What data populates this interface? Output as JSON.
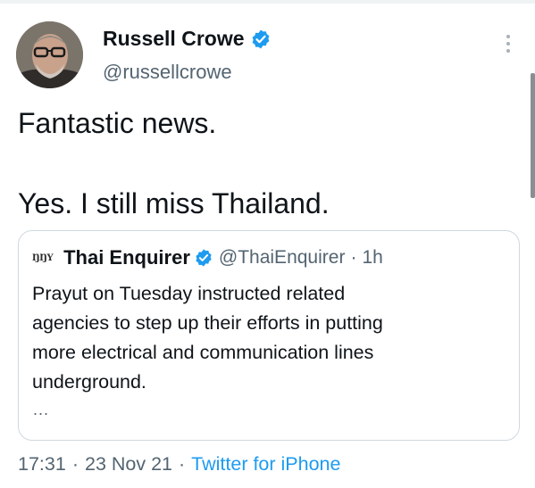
{
  "author": {
    "name": "Russell Crowe",
    "handle": "@russellcrowe",
    "verified": true,
    "avatar_icon": "profile-photo"
  },
  "tweet": {
    "lines": [
      "Fantastic news.",
      "Yes. I still miss Thailand."
    ]
  },
  "quote": {
    "logo_text": "ŊŊY",
    "name": "Thai Enquirer",
    "verified": true,
    "handle": "@ThaiEnquirer",
    "separator": "·",
    "time": "1h",
    "body_lines": [
      "Prayut on Tuesday instructed related",
      "agencies to step up their efforts in putting",
      "more electrical and communication lines",
      "underground."
    ],
    "truncation": "..."
  },
  "meta": {
    "time": "17:31",
    "separator": "·",
    "date": "23 Nov 21",
    "source": "Twitter for iPhone"
  },
  "colors": {
    "primary_text": "#0f1419",
    "secondary_text": "#536471",
    "link_blue": "#1d9bf0",
    "verified_blue": "#1d9bf0",
    "border": "#cfd9de"
  },
  "icons": {
    "verified": "verified-badge-icon",
    "more": "more-options-icon"
  }
}
